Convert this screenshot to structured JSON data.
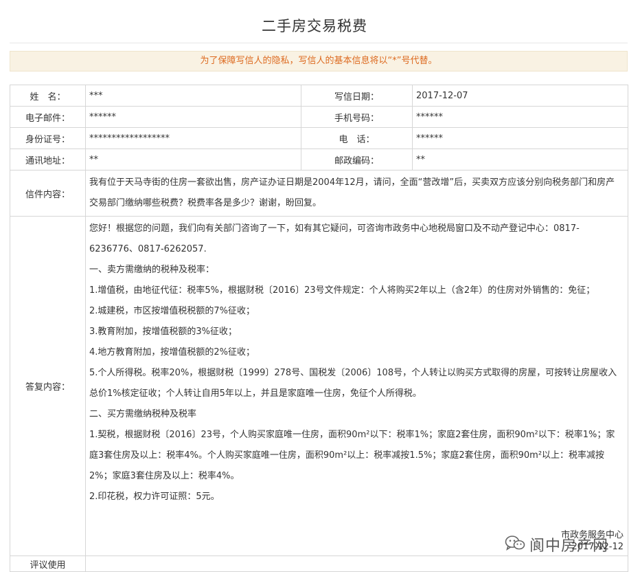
{
  "page": {
    "title": "二手房交易税费",
    "privacy_notice": "为了保障写信人的隐私，写信人的基本信息将以“*”号代替。"
  },
  "fields": {
    "name_label": "姓　名：",
    "name_value": "***",
    "date_label": "写信日期：",
    "date_value": "2017-12-07",
    "email_label": "电子邮件：",
    "email_value": "******",
    "mobile_label": "手机号码：",
    "mobile_value": "******",
    "id_label": "身份证号：",
    "id_value": "******************",
    "phone_label": "电　话：",
    "phone_value": "******",
    "address_label": "通讯地址：",
    "address_value": "**",
    "postcode_label": "邮政编码：",
    "postcode_value": "**",
    "letter_label": "信件内容：",
    "letter_text": "我有位于天马寺街的住房一套欲出售，房产证办证日期是2004年12月，请问，全面“营改增”后，买卖双方应该分别向税务部门和房产交易部门缴纳哪些税费？税费率各是多少？谢谢，盼回复。",
    "reply_label": "答复内容：",
    "next_row_label": "评议使用"
  },
  "reply": {
    "paragraphs": [
      "您好！根据您的问题，我们向有关部门咨询了一下，如有其它疑问，可咨询市政务中心地税局窗口及不动产登记中心：0817-6236776、0817-6262057.",
      "一、卖方需缴纳的税种及税率：",
      "1.增值税，由地征代征：税率5%，根据财税〔2016〕23号文件规定：个人将购买2年以上（含2年）的住房对外销售的：免征；",
      "2.城建税，市区按增值税税额的7%征收；",
      "3.教育附加，按增值税额的3%征收；",
      "4.地方教育附加，按增值税额的2%征收；",
      "5.个人所得税。税率20%，根据财税〔1999〕278号、国税发〔2006〕108号，个人转让以购买方式取得的房屋，可按转让房屋收入总价1%核定征收；个人转让自用5年以上，并且是家庭唯一住房，免征个人所得税。",
      "二、买方需缴纳税种及税率",
      "1.契税，根据财税〔2016〕23号，个人购买家庭唯一住房，面积90m²以下：税率1%；家庭2套住房，面积90m²以下：税率1%；家庭3套住房及以上：税率4%。个人购买家庭唯一住房，面积90m²以上：税率减按1.5%；家庭2套住房，面积90m²以上：税率减按2%；家庭3套住房及以上：税率4%。",
      "2.印花税，权力许可证照：5元。"
    ],
    "signature": "市政务服务中心",
    "reply_date": "2017-12-12"
  },
  "watermark": {
    "icon": "wechat-icon",
    "text": "阆中房产网"
  },
  "colors": {
    "notice_bg": "#f9f2e3",
    "notice_text": "#dd6a20",
    "border": "#d6d6d6"
  }
}
